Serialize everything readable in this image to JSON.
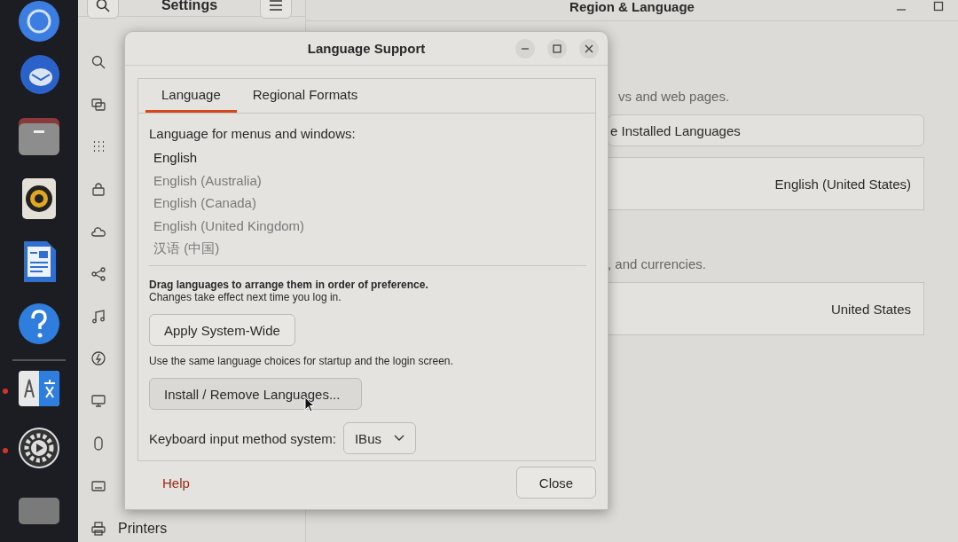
{
  "dock": [
    {
      "kind": "browser",
      "running": false
    },
    {
      "kind": "mail",
      "running": false
    },
    {
      "kind": "folder",
      "running": false
    },
    {
      "kind": "speaker",
      "running": false
    },
    {
      "kind": "document",
      "running": false
    },
    {
      "kind": "help",
      "running": false
    },
    {
      "kind": "translate",
      "running": true
    },
    {
      "kind": "gear",
      "running": true
    },
    {
      "kind": "square",
      "running": false
    }
  ],
  "settings": {
    "title": "Settings",
    "printers_label": "Printers"
  },
  "region": {
    "title": "Region & Language",
    "language_hint": "vs and web pages.",
    "manage_button": "e Installed Languages",
    "language_value": "English (United States)",
    "formats_hint": ", and currencies.",
    "formats_value": "United States"
  },
  "dialog": {
    "title": "Language Support",
    "tabs": [
      {
        "label": "Language",
        "selected": true
      },
      {
        "label": "Regional Formats",
        "selected": false
      }
    ],
    "list_label": "Language for menus and windows:",
    "languages": [
      {
        "name": "English",
        "dimmed": false
      },
      {
        "name": "English (Australia)",
        "dimmed": true
      },
      {
        "name": "English (Canada)",
        "dimmed": true
      },
      {
        "name": "English (United Kingdom)",
        "dimmed": true
      },
      {
        "name": "汉语 (中国)",
        "dimmed": true
      }
    ],
    "drag_hint": "Drag languages to arrange them in order of preference.",
    "drag_note": "Changes take effect next time you log in.",
    "apply_button": "Apply System-Wide",
    "apply_note": "Use the same language choices for startup and the login screen.",
    "install_button": "Install / Remove Languages...",
    "keyboard_label": "Keyboard input method system:",
    "keyboard_value": "IBus",
    "help_button": "Help",
    "close_button": "Close"
  }
}
